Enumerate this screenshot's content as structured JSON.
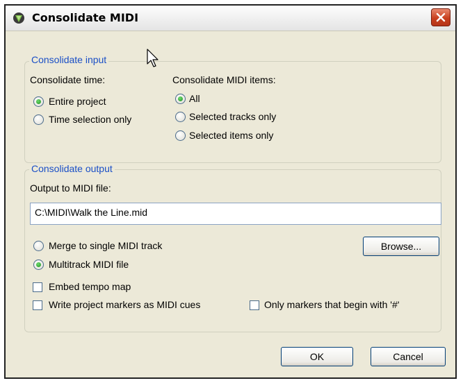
{
  "window": {
    "title": "Consolidate MIDI",
    "app_icon": "reaper-icon",
    "close_icon": "close-icon"
  },
  "input_group": {
    "title": "Consolidate input",
    "time_label": "Consolidate time:",
    "time_options": [
      {
        "label": "Entire project",
        "selected": true
      },
      {
        "label": "Time selection only",
        "selected": false
      }
    ],
    "items_label": "Consolidate MIDI items:",
    "items_options": [
      {
        "label": "All",
        "selected": true
      },
      {
        "label": "Selected tracks only",
        "selected": false
      },
      {
        "label": "Selected items only",
        "selected": false
      }
    ]
  },
  "output_group": {
    "title": "Consolidate output",
    "file_label": "Output to MIDI file:",
    "file_value": "C:\\MIDI\\Walk the Line.mid",
    "format_options": [
      {
        "label": "Merge to single MIDI track",
        "selected": false
      },
      {
        "label": "Multitrack MIDI file",
        "selected": true
      }
    ],
    "browse_label": "Browse...",
    "embed_tempo_label": "Embed tempo map",
    "embed_tempo_checked": false,
    "write_markers_label": "Write project markers as MIDI cues",
    "write_markers_checked": false,
    "only_markers_label": "Only markers that begin with '#'",
    "only_markers_checked": false
  },
  "buttons": {
    "ok": "OK",
    "cancel": "Cancel"
  },
  "colors": {
    "group_title": "#1a4fc6",
    "dialog_bg": "#ece9d8",
    "close_button": "#c8401e"
  }
}
